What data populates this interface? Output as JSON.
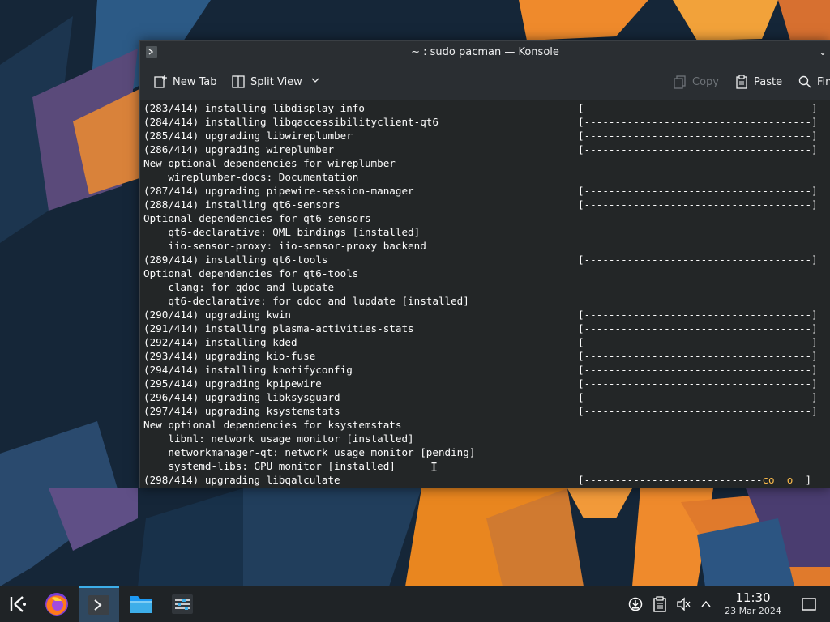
{
  "window": {
    "title": "~ : sudo pacman — Konsole"
  },
  "toolbar": {
    "new_tab": "New Tab",
    "split_view": "Split View",
    "copy": "Copy",
    "paste": "Paste",
    "find": "Fin"
  },
  "terminal": {
    "lines": [
      "(283/414) installing libdisplay-info",
      "(284/414) installing libqaccessibilityclient-qt6",
      "(285/414) upgrading libwireplumber",
      "(286/414) upgrading wireplumber",
      "New optional dependencies for wireplumber",
      "    wireplumber-docs: Documentation",
      "(287/414) upgrading pipewire-session-manager",
      "(288/414) installing qt6-sensors",
      "Optional dependencies for qt6-sensors",
      "    qt6-declarative: QML bindings [installed]",
      "    iio-sensor-proxy: iio-sensor-proxy backend",
      "(289/414) installing qt6-tools",
      "Optional dependencies for qt6-tools",
      "    clang: for qdoc and lupdate",
      "    qt6-declarative: for qdoc and lupdate [installed]",
      "(290/414) upgrading kwin",
      "(291/414) installing plasma-activities-stats",
      "(292/414) installing kded",
      "(293/414) upgrading kio-fuse",
      "(294/414) installing knotifyconfig",
      "(295/414) upgrading kpipewire",
      "(296/414) upgrading libksysguard",
      "(297/414) upgrading ksystemstats",
      "New optional dependencies for ksystemstats",
      "    libnl: network usage monitor [installed]",
      "    networkmanager-qt: network usage monitor [pending]",
      "    systemd-libs: GPU monitor [installed]",
      "(298/414) upgrading libqalculate"
    ],
    "full_bar": "[-------------------------------------]",
    "partial_bar_dashes": "[-----------------------------",
    "partial_bar_progress": "co  o  ",
    "partial_bar_end": "]"
  },
  "taskbar": {
    "time": "11:30",
    "date": "23 Mar 2024"
  },
  "colors": {
    "accent": "#3daee9",
    "pacman": "#fdbc4b"
  }
}
